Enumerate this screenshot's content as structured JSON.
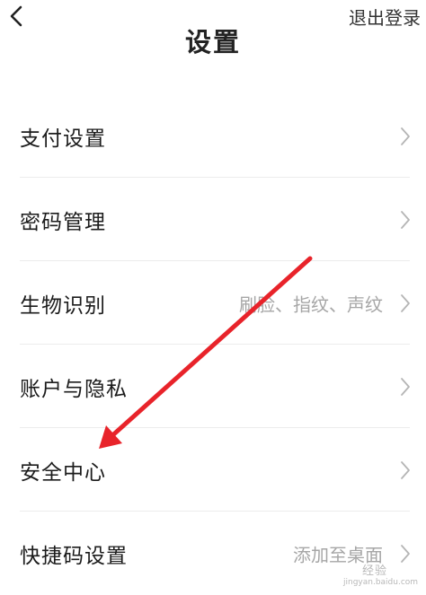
{
  "header": {
    "title": "设置",
    "logout_label": "退出登录",
    "back_icon": "chevron-left-icon"
  },
  "menu": {
    "items": [
      {
        "label": "支付设置",
        "value": ""
      },
      {
        "label": "密码管理",
        "value": ""
      },
      {
        "label": "生物识别",
        "value": "刷脸、指纹、声纹"
      },
      {
        "label": "账户与隐私",
        "value": ""
      },
      {
        "label": "安全中心",
        "value": ""
      },
      {
        "label": "快捷码设置",
        "value": "添加至桌面"
      }
    ]
  },
  "annotation": {
    "color": "#e8232a"
  },
  "watermark": {
    "badge": "经验",
    "url": "jingyan.baidu.com"
  }
}
